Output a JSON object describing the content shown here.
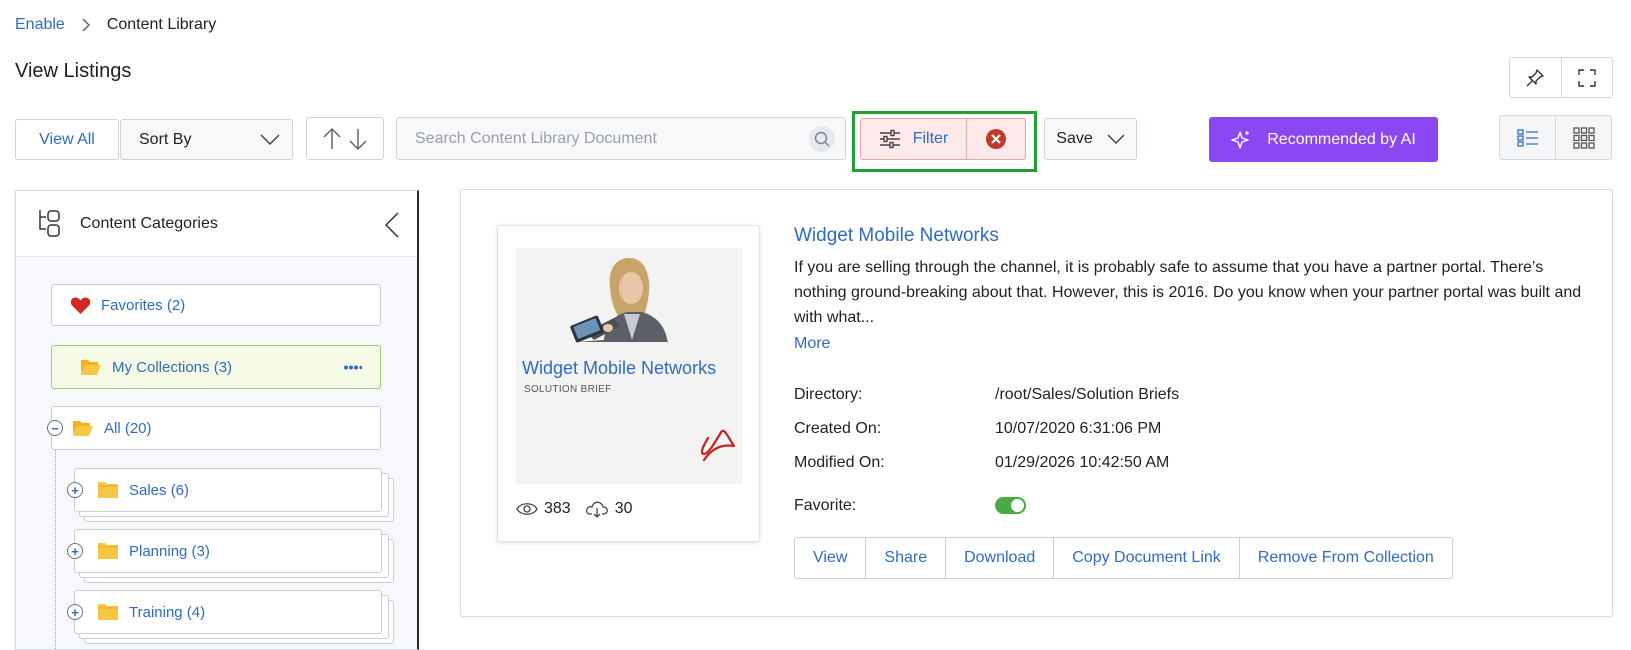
{
  "breadcrumb": {
    "root": "Enable",
    "current": "Content Library"
  },
  "page_title": "View Listings",
  "toolbar": {
    "view_all": "View All",
    "sort_by": "Sort By",
    "search_placeholder": "Search Content Library Document",
    "filter": "Filter",
    "save": "Save",
    "ai": "Recommended by AI"
  },
  "sidebar": {
    "title": "Content Categories",
    "favorites": "Favorites (2)",
    "collections": "My Collections (3)",
    "all": "All (20)",
    "folders": [
      "Sales (6)",
      "Planning (3)",
      "Training (4)"
    ]
  },
  "document": {
    "thumb_title": "Widget Mobile Networks",
    "thumb_subtitle": "SOLUTION BRIEF",
    "views": "383",
    "downloads": "30",
    "title": "Widget Mobile Networks",
    "description": "If you are selling through the channel, it is probably safe to assume that you have a partner portal. There’s nothing ground-breaking about that. However, this is 2016. Do you know when your partner portal was built and with what...",
    "more": "More",
    "directory_label": "Directory:",
    "directory": "/root/Sales/Solution Briefs",
    "created_label": "Created On:",
    "created": "10/07/2020 6:31:06 PM",
    "modified_label": "Modified On:",
    "modified": "01/29/2026 10:42:50 AM",
    "favorite_label": "Favorite:",
    "favorite": true
  },
  "actions": [
    "View",
    "Share",
    "Download",
    "Copy Document Link",
    "Remove From Collection"
  ],
  "colors": {
    "link": "#2f6bc4",
    "ai_button": "#8b47f2",
    "filter_highlight": "#21a038",
    "toggle_on": "#49a942",
    "collections_bg": "#f5fbe6"
  }
}
